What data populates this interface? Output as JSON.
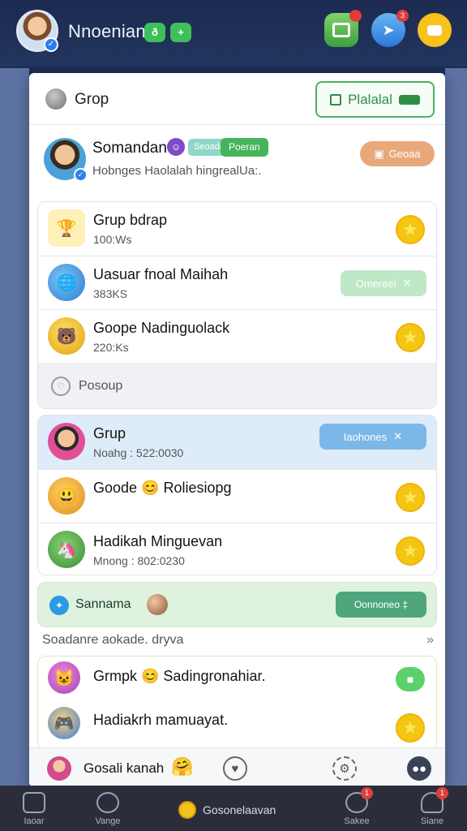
{
  "header": {
    "username": "Nnoenian",
    "chip1": "ð",
    "chip2": "+",
    "icons": [
      {
        "name": "gift-icon",
        "badge": ""
      },
      {
        "name": "share-icon",
        "badge": "3"
      },
      {
        "name": "chat-icon",
        "badge": ""
      }
    ]
  },
  "panel": {
    "title": "Grop",
    "head_button": "Plalalal",
    "profile": {
      "name": "Somandan",
      "tag1": "Seoade",
      "tag2": "Poeran",
      "subtitle": "Hobnges Haolalah hingrealUa:.",
      "button": "Geoaa"
    },
    "card1": {
      "rows": [
        {
          "title": "Grup bdrap",
          "sub": "100:Ws",
          "action": "star"
        },
        {
          "title": "Uasuar fnoal Maihah",
          "sub": "383KS",
          "action": "Omereel"
        },
        {
          "title": "Goope Nadinguolack",
          "sub": "220:Ks",
          "action": "star"
        }
      ],
      "footer": "Posoup"
    },
    "card2": {
      "rows": [
        {
          "title": "Grup",
          "sub": "Noahg : 522:0030",
          "action": "Iaohones"
        },
        {
          "title": "Goode 😊 Roliesiopg",
          "sub": "",
          "action": "star"
        },
        {
          "title": "Hadikah Minguevan",
          "sub": "Mnong : 802:0230",
          "action": "star"
        }
      ]
    },
    "promo": {
      "label": "Sannama",
      "button": "Oonnoneo ‡"
    },
    "suggest": {
      "label": "Soadanre aokade. dryva",
      "chevron": "»"
    },
    "card3": {
      "rows": [
        {
          "title": "Grmpk 😊 Sadingronahiar.",
          "action": "chat"
        },
        {
          "title": "Hadiakrh mamuayat.",
          "action": "star"
        }
      ]
    },
    "bottom_strip": {
      "name": "Gosali kanah",
      "emoji": "🤗"
    }
  },
  "bottom_nav": {
    "items": [
      {
        "label": "Iaoar",
        "badge": ""
      },
      {
        "label": "Vange",
        "badge": ""
      },
      {
        "label": "Sakee",
        "badge": "1"
      },
      {
        "label": "Siane",
        "badge": "1"
      }
    ],
    "center_label": "Gosonelaavan"
  },
  "colors": {
    "accent_green": "#45b55b",
    "star_yellow": "#f3c612",
    "nav_bg": "#2b2e3a"
  }
}
